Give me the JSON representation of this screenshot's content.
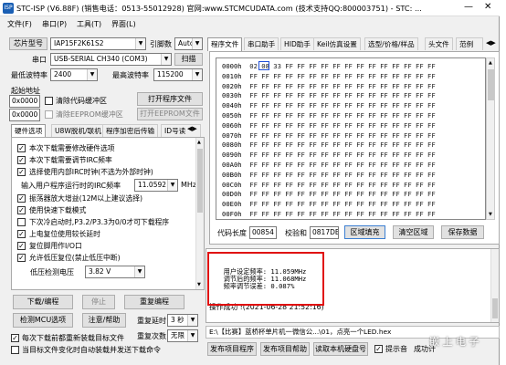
{
  "window": {
    "title": "STC-ISP (V6.88F) (销售电话：0513-55012928) 官网:www.STCMCUDATA.com  (技术支持QQ:800003751) - STC: ...",
    "minimize": "—",
    "close_hint": "✕"
  },
  "menu": [
    "文件(F)",
    "串口(P)",
    "工具(T)",
    "界面(L)"
  ],
  "left": {
    "chip_model_button": "芯片型号",
    "chip_model_value": "IAP15F2K61S2",
    "pins_label": "引脚数",
    "pins_value": "Auto",
    "port_label": "串口",
    "port_value": "USB-SERIAL CH340 (COM3)",
    "scan_button": "扫描",
    "min_baud_label": "最低波特率",
    "min_baud_value": "2400",
    "max_baud_label": "最高波特率",
    "max_baud_value": "115200",
    "start_addr_label": "起始地址",
    "addr1": "0x0000",
    "clear_code_label": "清除代码缓冲区",
    "open_program_button": "打开程序文件",
    "addr2": "0x0000",
    "clear_eeprom_label": "清除EEPROM缓冲区",
    "open_eeprom_button": "打开EEPROM文件",
    "tabs": [
      "硬件选项",
      "U8W脱机/联机",
      "程序加密后传输",
      "ID号读"
    ],
    "options": [
      {
        "text": "本次下载需要修改硬件选项",
        "checked": true
      },
      {
        "text": "本次下载需要调节IRC频率",
        "checked": true
      },
      {
        "text": "选择使用内部IRC时钟(不选为外部时钟)",
        "checked": true
      },
      {
        "text": "使用快速下载模式",
        "checked": true
      },
      {
        "text": "振荡器放大增益(12M以上建议选择)",
        "checked": true
      },
      {
        "text": "下次冷启动时,P3.2/P3.3为0/0才可下载程序",
        "checked": false
      },
      {
        "text": "上电复位使用较长延时",
        "checked": true
      },
      {
        "text": "复位脚用作I/O口",
        "checked": true
      },
      {
        "text": "允许低压复位(禁止低压中断)",
        "checked": true
      }
    ],
    "irc_freq_label": "输入用户程序运行时的IRC频率",
    "irc_freq_value": "11.0592",
    "irc_unit": "MHz",
    "lv_label": "低压检测电压",
    "lv_value": "3.82 V",
    "download_button": "下载/编程",
    "stop_button": "停止",
    "reprogram_button": "重复编程",
    "detect_button": "检测MCU选项",
    "help_button": "注意/帮助",
    "repeat_delay_label": "重复延时",
    "repeat_delay_value": "3 秒",
    "repeat_count_label": "重复次数",
    "repeat_count_value": "无限",
    "auto_reload_label": "每次下载前都重新装载目标文件",
    "auto_send_label": "当目标文件变化时自动装载并发送下载命令"
  },
  "right": {
    "tabs": [
      "程序文件",
      "串口助手",
      "HID助手",
      "Keil仿真设置",
      "选型/价格/样品",
      "头文件",
      "范例"
    ],
    "hex_rows": [
      {
        "addr": "0000h",
        "bytes": "02 08 33 FF FF FF FF FF FF FF FF FF FF FF FF FF"
      },
      {
        "addr": "0010h",
        "bytes": "FF FF FF FF FF FF FF FF FF FF FF FF FF FF FF FF"
      },
      {
        "addr": "0020h",
        "bytes": "FF FF FF FF FF FF FF FF FF FF FF FF FF FF FF FF"
      },
      {
        "addr": "0030h",
        "bytes": "FF FF FF FF FF FF FF FF FF FF FF FF FF FF FF FF"
      },
      {
        "addr": "0040h",
        "bytes": "FF FF FF FF FF FF FF FF FF FF FF FF FF FF FF FF"
      },
      {
        "addr": "0050h",
        "bytes": "FF FF FF FF FF FF FF FF FF FF FF FF FF FF FF FF"
      },
      {
        "addr": "0060h",
        "bytes": "FF FF FF FF FF FF FF FF FF FF FF FF FF FF FF FF"
      },
      {
        "addr": "0070h",
        "bytes": "FF FF FF FF FF FF FF FF FF FF FF FF FF FF FF FF"
      },
      {
        "addr": "0080h",
        "bytes": "FF FF FF FF FF FF FF FF FF FF FF FF FF FF FF FF"
      },
      {
        "addr": "0090h",
        "bytes": "FF FF FF FF FF FF FF FF FF FF FF FF FF FF FF FF"
      },
      {
        "addr": "00A0h",
        "bytes": "FF FF FF FF FF FF FF FF FF FF FF FF FF FF FF FF"
      },
      {
        "addr": "00B0h",
        "bytes": "FF FF FF FF FF FF FF FF FF FF FF FF FF FF FF FF"
      },
      {
        "addr": "00C0h",
        "bytes": "FF FF FF FF FF FF FF FF FF FF FF FF FF FF FF FF"
      },
      {
        "addr": "00D0h",
        "bytes": "FF FF FF FF FF FF FF FF FF FF FF FF FF FF FF FF"
      },
      {
        "addr": "00E0h",
        "bytes": "FF FF FF FF FF FF FF FF FF FF FF FF FF FF FF FF"
      },
      {
        "addr": "00F0h",
        "bytes": "FF FF FF FF FF FF FF FF FF FF FF FF FF FF FF FF"
      }
    ],
    "code_len_label": "代码长度",
    "code_len_value": "00854",
    "checksum_label": "校验和",
    "checksum_value": "0817DB",
    "fill_button": "区域填充",
    "clear_button": "清空区域",
    "save_button": "保存数据",
    "log_lines": [
      "  用户设定频率: 11.059MHz",
      "  调节后的频率: 11.068MHz",
      "  频率调节误差: 0.087%"
    ],
    "log_success": "操作成功 !(2021-06-28 21:52:16)",
    "status_path": "E:\\【比赛】蓝桥杯单片机一微信公...\\01，点亮一个LED.hex",
    "send_custom_button": "发布项目程序",
    "send_help_button": "发布项目帮助",
    "read_serial_button": "读取本机硬盘号",
    "beep_label": "提示音",
    "success_count_label": "成功计",
    "watermark": "嵌 上 电 子"
  }
}
